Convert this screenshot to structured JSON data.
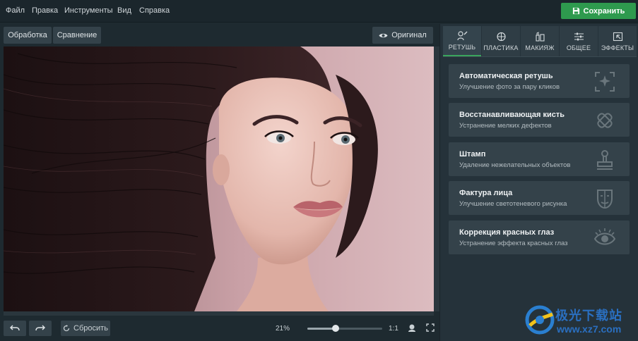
{
  "menu": {
    "items": [
      "Файл",
      "Правка",
      "Инструменты",
      "Вид",
      "Справка"
    ],
    "save_label": "Сохранить"
  },
  "toolbar": {
    "processing_label": "Обработка",
    "compare_label": "Сравнение",
    "original_label": "Оригинал"
  },
  "bottom": {
    "reset_label": "Сбросить",
    "zoom_level": "21%",
    "zoom_fraction": 0.38,
    "actual_size_label": "1:1"
  },
  "tabs": [
    {
      "label": "РЕТУШЬ",
      "icon": "retouch-icon",
      "active": true
    },
    {
      "label": "ПЛАСТИКА",
      "icon": "plastic-icon",
      "active": false
    },
    {
      "label": "МАКИЯЖ",
      "icon": "makeup-icon",
      "active": false
    },
    {
      "label": "ОБЩЕЕ",
      "icon": "sliders-icon",
      "active": false
    },
    {
      "label": "ЭФФЕКТЫ",
      "icon": "effects-icon",
      "active": false
    }
  ],
  "tools": [
    {
      "title": "Автоматическая ретушь",
      "desc": "Улучшение фото за пару кликов",
      "icon": "auto-retouch-icon"
    },
    {
      "title": "Восстанавливающая кисть",
      "desc": "Устранение мелких дефектов",
      "icon": "healing-brush-icon"
    },
    {
      "title": "Штамп",
      "desc": "Удаление нежелательных объектов",
      "icon": "stamp-icon"
    },
    {
      "title": "Фактура лица",
      "desc": "Улучшение светотеневого рисунка",
      "icon": "face-texture-icon"
    },
    {
      "title": "Коррекция красных глаз",
      "desc": "Устранение эффекта красных глаз",
      "icon": "red-eye-icon"
    }
  ],
  "watermark": {
    "brand": "极光下载站",
    "url": "www.xz7.com"
  },
  "colors": {
    "accent": "#2e9a4e",
    "active_tab_underline": "#3aa55d",
    "background": "#1e2a30"
  }
}
